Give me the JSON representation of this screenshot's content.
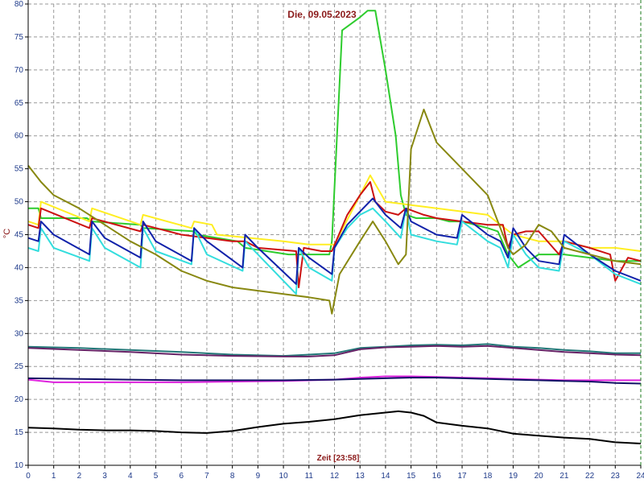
{
  "chart_data": {
    "type": "line",
    "title": "Die, 09.05.2023",
    "xlabel": "Zeit [23:58]",
    "ylabel": "°C",
    "xlim": [
      0,
      24
    ],
    "ylim": [
      10,
      80
    ],
    "x_ticks": [
      "0",
      "1",
      "2",
      "3",
      "4",
      "5",
      "6",
      "7",
      "8",
      "9",
      "10",
      "11",
      "12",
      "13",
      "14",
      "15",
      "16",
      "17",
      "18",
      "19",
      "20",
      "21",
      "22",
      "23",
      "24"
    ],
    "y_ticks": [
      "10",
      "15",
      "20",
      "25",
      "30",
      "35",
      "40",
      "45",
      "50",
      "55",
      "60",
      "65",
      "70",
      "75",
      "80"
    ],
    "grid": true,
    "series": [
      {
        "color": "#2ecc2e",
        "x": [
          0,
          0.4,
          0.5,
          2.3,
          2.5,
          4.4,
          4.5,
          6.5,
          6.6,
          8.2,
          8.5,
          10.2,
          10.6,
          11.6,
          11.8,
          11.9,
          12.3,
          13.0,
          13.3,
          13.6,
          14.0,
          14.4,
          14.6,
          14.8,
          15.2,
          16.0,
          16.5,
          17.0,
          18.0,
          18.4,
          18.8,
          19.2,
          20.0,
          21.0,
          22.0,
          23.0,
          24.0
        ],
        "y": [
          49,
          49,
          47.5,
          47.5,
          47,
          46.5,
          46,
          45.5,
          45,
          44,
          43,
          42,
          42,
          42,
          42,
          44,
          76,
          78,
          79,
          79,
          70,
          60,
          51,
          48,
          47.5,
          47.5,
          47,
          47,
          46,
          45.5,
          42,
          40,
          42,
          42,
          41.5,
          41,
          41
        ]
      },
      {
        "color": "#ffee22",
        "x": [
          0,
          0.4,
          0.5,
          2.4,
          2.5,
          4.4,
          4.5,
          6.4,
          6.5,
          7.2,
          7.4,
          10.0,
          11.0,
          12.0,
          13.0,
          13.4,
          14.0,
          15.0,
          16.0,
          17.0,
          18.0,
          19.0,
          20.0,
          21.0,
          22.0,
          23.0,
          24.0
        ],
        "y": [
          47,
          46.5,
          50,
          47,
          49,
          46.5,
          48,
          46,
          47,
          46.5,
          45,
          44,
          43.5,
          43.5,
          51,
          54,
          50,
          49.5,
          49,
          48.5,
          48,
          45,
          44,
          44,
          43,
          43,
          42.5
        ]
      },
      {
        "color": "#cc1111",
        "x": [
          0,
          0.4,
          0.5,
          2.4,
          2.5,
          4.4,
          4.5,
          6.0,
          7.0,
          8.0,
          8.5,
          9.0,
          10.5,
          10.6,
          10.8,
          11.5,
          11.9,
          12.5,
          13.0,
          13.4,
          13.6,
          14.0,
          14.5,
          14.8,
          15.5,
          16.0,
          17.0,
          18.0,
          18.6,
          18.8,
          19.0,
          19.5,
          20.0,
          20.8,
          21.0,
          21.5,
          22.0,
          22.8,
          23.0,
          23.5,
          24.0
        ],
        "y": [
          46.5,
          46,
          49,
          46,
          47.5,
          45.5,
          46.5,
          45,
          44.5,
          44,
          44,
          43,
          42.5,
          37,
          43,
          42.5,
          42.5,
          48,
          51,
          53,
          50,
          48.5,
          48,
          49,
          48,
          47.5,
          47,
          46.5,
          46.5,
          43,
          45,
          45.5,
          45.5,
          42,
          44,
          43.5,
          43,
          42,
          38,
          41.5,
          41
        ]
      },
      {
        "color": "#33dddd",
        "x": [
          0,
          0.4,
          0.5,
          1.0,
          2.4,
          2.5,
          3.0,
          4.4,
          4.5,
          5.0,
          6.4,
          6.5,
          7.0,
          8.4,
          8.5,
          9.0,
          10.5,
          10.6,
          11.0,
          11.9,
          12.0,
          12.5,
          13.0,
          13.5,
          14.0,
          14.6,
          14.8,
          15.0,
          16.0,
          16.8,
          17.0,
          18.0,
          18.5,
          18.8,
          19.0,
          19.5,
          20.0,
          20.8,
          21.0,
          22.0,
          23.0,
          24.0
        ],
        "y": [
          43,
          42.5,
          46,
          43,
          41,
          46,
          43,
          40,
          46,
          42.5,
          40.5,
          46,
          42,
          39.5,
          44,
          42,
          36,
          43,
          40,
          38,
          43,
          46,
          48,
          49,
          47,
          44.5,
          49,
          45,
          44,
          43.5,
          47,
          44,
          43,
          40,
          45,
          42,
          40,
          39.5,
          44,
          42,
          39,
          37.5
        ]
      },
      {
        "color": "#1122aa",
        "x": [
          0,
          0.4,
          0.5,
          1.0,
          2.4,
          2.5,
          3.0,
          4.4,
          4.5,
          5.0,
          6.4,
          6.5,
          7.0,
          8.4,
          8.5,
          9.0,
          10.5,
          10.6,
          11.0,
          11.9,
          12.0,
          12.5,
          13.0,
          13.5,
          14.0,
          14.6,
          14.8,
          15.0,
          16.0,
          16.8,
          17.0,
          18.0,
          18.5,
          18.8,
          19.0,
          19.5,
          20.0,
          20.8,
          21.0,
          22.0,
          23.0,
          24.0
        ],
        "y": [
          44.5,
          44,
          47,
          45,
          42,
          47,
          44.5,
          41.5,
          47,
          44,
          41,
          46,
          44,
          40,
          45,
          43,
          37.5,
          43,
          41.5,
          39,
          43,
          46.5,
          48.5,
          50.5,
          48,
          46,
          49,
          47,
          45,
          44.5,
          48,
          45,
          44,
          41.5,
          46,
          43,
          41,
          40.5,
          45,
          42,
          39.5,
          38
        ]
      },
      {
        "color": "#888811",
        "x": [
          0,
          0.5,
          1.0,
          2.0,
          3.0,
          4.0,
          5.0,
          6.0,
          7.0,
          8.0,
          9.0,
          10.0,
          11.0,
          11.8,
          11.9,
          12.2,
          13.0,
          13.5,
          14.0,
          14.5,
          14.8,
          15.0,
          15.5,
          16.0,
          17.0,
          18.0,
          18.5,
          18.8,
          19.0,
          19.5,
          20.0,
          20.5,
          21.0,
          22.0,
          23.0,
          24.0
        ],
        "y": [
          55.5,
          53,
          51,
          49,
          46.5,
          44,
          42,
          39.5,
          38,
          37,
          36.5,
          36,
          35.5,
          35,
          33,
          39,
          44,
          47,
          44,
          40.5,
          42,
          58,
          64,
          59,
          55,
          51,
          46,
          43,
          42,
          43.5,
          46.5,
          45.5,
          43,
          42,
          41,
          40.5
        ]
      },
      {
        "color": "#227777",
        "x": [
          0,
          2,
          4,
          6,
          8,
          10,
          11,
          12,
          13,
          14,
          15,
          16,
          17,
          18,
          19,
          20,
          21,
          22,
          23,
          24
        ],
        "y": [
          28,
          27.8,
          27.5,
          27.2,
          26.8,
          26.6,
          26.8,
          27.0,
          27.8,
          28.0,
          28.2,
          28.3,
          28.2,
          28.4,
          28.0,
          27.8,
          27.5,
          27.3,
          27.0,
          27.0
        ]
      },
      {
        "color": "#662266",
        "x": [
          0,
          2,
          4,
          6,
          8,
          10,
          11,
          12,
          13,
          14,
          15,
          16,
          17,
          18,
          19,
          20,
          21,
          22,
          23,
          24
        ],
        "y": [
          27.8,
          27.5,
          27.2,
          26.8,
          26.6,
          26.5,
          26.5,
          26.7,
          27.6,
          27.9,
          28.0,
          28.1,
          28.0,
          28.1,
          27.8,
          27.5,
          27.2,
          27.0,
          26.8,
          26.7
        ]
      },
      {
        "color": "#dd22dd",
        "x": [
          0,
          1,
          2,
          4,
          6,
          8,
          10,
          12,
          13,
          14,
          15,
          16,
          17,
          18,
          19,
          20,
          21,
          22,
          23,
          24
        ],
        "y": [
          23,
          22.6,
          22.6,
          22.6,
          22.6,
          22.7,
          22.8,
          23.0,
          23.3,
          23.5,
          23.5,
          23.4,
          23.3,
          23.2,
          23.1,
          23.0,
          22.9,
          22.9,
          22.9,
          22.9
        ]
      },
      {
        "color": "#111166",
        "x": [
          0,
          2,
          4,
          6,
          8,
          10,
          12,
          13,
          14,
          15,
          16,
          17,
          18,
          19,
          20,
          21,
          22,
          23,
          24
        ],
        "y": [
          23.2,
          23.1,
          23.0,
          22.9,
          22.9,
          22.9,
          23.0,
          23.1,
          23.2,
          23.3,
          23.3,
          23.2,
          23.1,
          23.0,
          22.9,
          22.8,
          22.7,
          22.5,
          22.4
        ]
      },
      {
        "color": "#000000",
        "x": [
          0,
          1,
          2,
          3,
          4,
          5,
          6,
          7,
          8,
          9,
          10,
          11,
          12,
          13,
          14,
          14.5,
          15,
          15.5,
          16,
          17,
          18,
          19,
          20,
          21,
          22,
          23,
          24
        ],
        "y": [
          15.7,
          15.6,
          15.4,
          15.3,
          15.3,
          15.2,
          15.0,
          14.9,
          15.2,
          15.8,
          16.3,
          16.6,
          17.0,
          17.6,
          18.0,
          18.2,
          18.0,
          17.5,
          16.5,
          16.0,
          15.6,
          14.8,
          14.5,
          14.2,
          14.0,
          13.5,
          13.3
        ]
      }
    ]
  }
}
